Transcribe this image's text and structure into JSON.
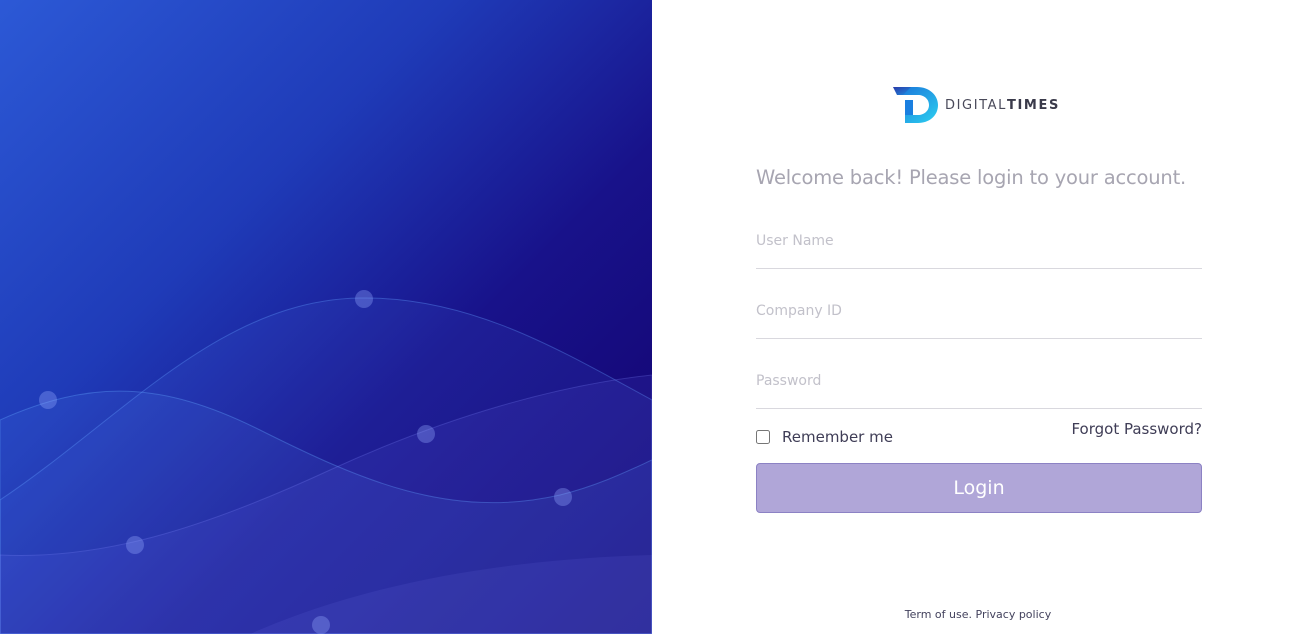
{
  "brand": {
    "name_regular": "DIGITAL",
    "name_bold": "TIMES",
    "logo_icon": "digitaltimes-d-logo-icon"
  },
  "login": {
    "welcome": "Welcome back! Please login to your account.",
    "username_placeholder": "User Name",
    "company_placeholder": "Company ID",
    "password_placeholder": "Password",
    "remember_label": "Remember me",
    "remember_checked": false,
    "forgot_label": "Forgot Password?",
    "submit_label": "Login"
  },
  "footer": {
    "terms": "Term of use.",
    "privacy": "Privacy policy"
  },
  "colors": {
    "gradient_light": "#2c59d6",
    "gradient_dark": "#12006a",
    "button_bg": "#b0a6d8",
    "text_muted": "#a7a5b1",
    "text_dark": "#3f3d56"
  }
}
